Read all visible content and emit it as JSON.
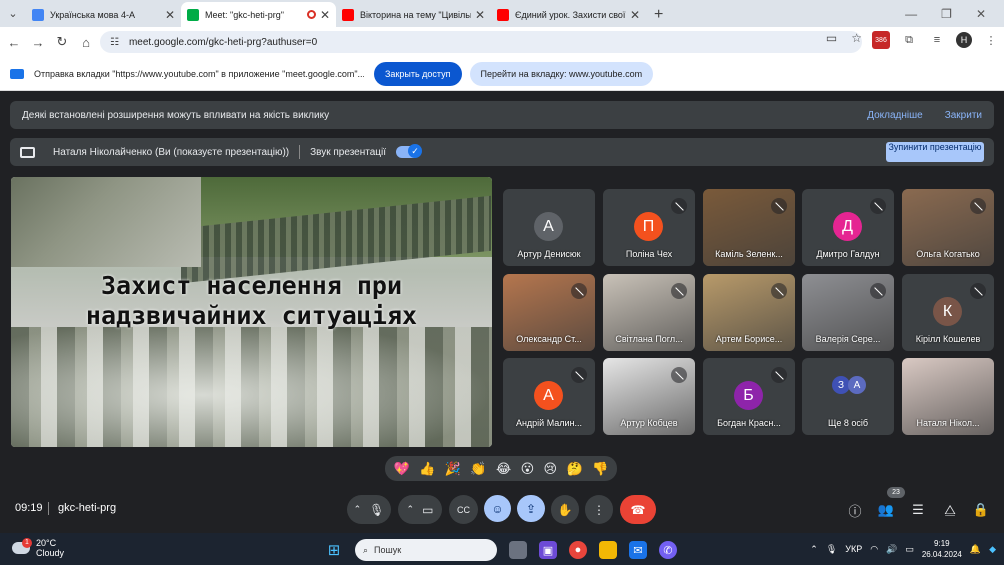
{
  "browser": {
    "tabs": [
      {
        "title": "Українська мова 4-А",
        "color": "#4285f4",
        "active": false
      },
      {
        "title": "Meet: \"gkc-heti-prg\"",
        "color": "#00ac47",
        "active": true
      },
      {
        "title": "Вікторина на тему \"Цивільний",
        "color": "#ff0000",
        "active": false
      },
      {
        "title": "Єдиний урок. Захисти свої",
        "color": "#ff0000",
        "active": false
      }
    ],
    "url": "meet.google.com/gkc-heti-prg?authuser=0",
    "profile_initial": "Н",
    "ext_badge": "386"
  },
  "infobar": {
    "message": "Отправка вкладки \"https://www.youtube.com\" в приложение \"meet.google.com\"...",
    "close_access": "Закрыть доступ",
    "switch_tab": "Перейти на вкладку: www.youtube.com"
  },
  "banner": {
    "text": "Деякі встановлені розширення можуть впливати на якість виклику",
    "details": "Докладніше",
    "close": "Закрити"
  },
  "presenting": {
    "text": "Наталя Ніколайченко (Ви (показуєте презентацію))",
    "sound_label": "Звук презентації",
    "stop_label": "Зупинити презентацію"
  },
  "slide": {
    "line1": "Захист населення при",
    "line2": "надзвичайних ситуаціях"
  },
  "participants": [
    {
      "name": "Артур Денисюк",
      "initial": "А",
      "color": "#5f6368",
      "video": false,
      "muted": false
    },
    {
      "name": "Поліна Чех",
      "initial": "П",
      "color": "#f4511e",
      "video": false,
      "muted": true
    },
    {
      "name": "Каміль Зеленк...",
      "initial": "",
      "color": "#7a5a3a",
      "video": true,
      "muted": true
    },
    {
      "name": "Дмитро Галдун",
      "initial": "Д",
      "color": "#e52592",
      "video": false,
      "muted": true
    },
    {
      "name": "Ольга Когатько",
      "initial": "",
      "color": "#8a6a50",
      "video": true,
      "muted": true
    },
    {
      "name": "Олександр Ст...",
      "initial": "",
      "color": "#b5764e",
      "video": true,
      "muted": true
    },
    {
      "name": "Світлана Погл...",
      "initial": "",
      "color": "#c9c2b8",
      "video": true,
      "muted": true
    },
    {
      "name": "Артем Борисе...",
      "initial": "",
      "color": "#b89a6a",
      "video": true,
      "muted": true
    },
    {
      "name": "Валерія Сере...",
      "initial": "",
      "color": "#8e8f93",
      "video": true,
      "muted": true
    },
    {
      "name": "Кірілл Кошелев",
      "initial": "К",
      "color": "#795548",
      "video": false,
      "muted": true
    },
    {
      "name": "Андрій Малин...",
      "initial": "А",
      "color": "#f4511e",
      "video": false,
      "muted": true
    },
    {
      "name": "Артур Кобцев",
      "initial": "",
      "color": "#e6e6e6",
      "video": true,
      "muted": true
    },
    {
      "name": "Богдан Красн...",
      "initial": "Б",
      "color": "#8e24aa",
      "video": false,
      "muted": true
    },
    {
      "name": "Ще 8 осіб",
      "initial": "",
      "color": "#3c4043",
      "video": false,
      "muted": false,
      "more": [
        "З",
        "А"
      ]
    },
    {
      "name": "Наталя Нікол...",
      "initial": "",
      "color": "#d9c9c3",
      "video": true,
      "muted": false
    }
  ],
  "reactions": [
    "💖",
    "👍",
    "🎉",
    "👏",
    "😂",
    "😮",
    "😢",
    "🤔",
    "👎"
  ],
  "meeting": {
    "time": "09:19",
    "code": "gkc-heti-prg",
    "participant_count": "23"
  },
  "taskbar": {
    "temp": "20°C",
    "weather": "Cloudy",
    "weather_badge": "1",
    "search": "Пошук",
    "lang": "УКР",
    "time": "9:19",
    "date": "26.04.2024"
  }
}
